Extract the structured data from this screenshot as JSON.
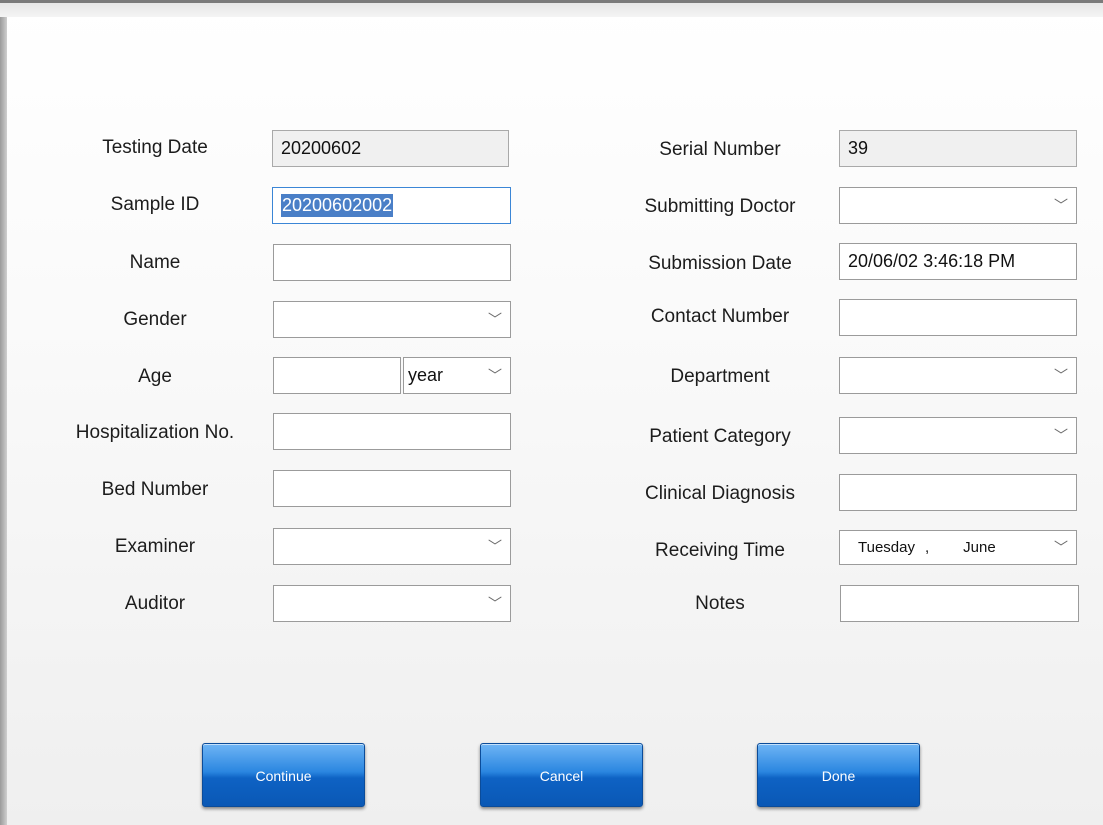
{
  "left": {
    "testing_date_label": "Testing Date",
    "testing_date_value": "20200602",
    "sample_id_label": "Sample ID",
    "sample_id_value": "20200602002",
    "name_label": "Name",
    "name_value": "",
    "gender_label": "Gender",
    "gender_value": "",
    "age_label": "Age",
    "age_value": "",
    "age_unit": "year",
    "hospitalization_label": "Hospitalization No.",
    "hospitalization_value": "",
    "bed_label": "Bed Number",
    "bed_value": "",
    "examiner_label": "Examiner",
    "examiner_value": "",
    "auditor_label": "Auditor",
    "auditor_value": ""
  },
  "right": {
    "serial_label": "Serial Number",
    "serial_value": "39",
    "doctor_label": "Submitting Doctor",
    "doctor_value": "",
    "submission_date_label": "Submission Date",
    "submission_date_value": "20/06/02 3:46:18 PM",
    "contact_label": "Contact Number",
    "contact_value": "",
    "department_label": "Department",
    "department_value": "",
    "patient_category_label": "Patient Category",
    "patient_category_value": "",
    "diagnosis_label": "Clinical Diagnosis",
    "diagnosis_value": "",
    "receiving_label": "Receiving Time",
    "receiving_day": "Tuesday",
    "receiving_sep": ",",
    "receiving_month": "June",
    "notes_label": "Notes",
    "notes_value": ""
  },
  "buttons": {
    "continue": "Continue",
    "cancel": "Cancel",
    "done": "Done"
  },
  "icons": {
    "dropdown": "chevron-down-icon"
  }
}
